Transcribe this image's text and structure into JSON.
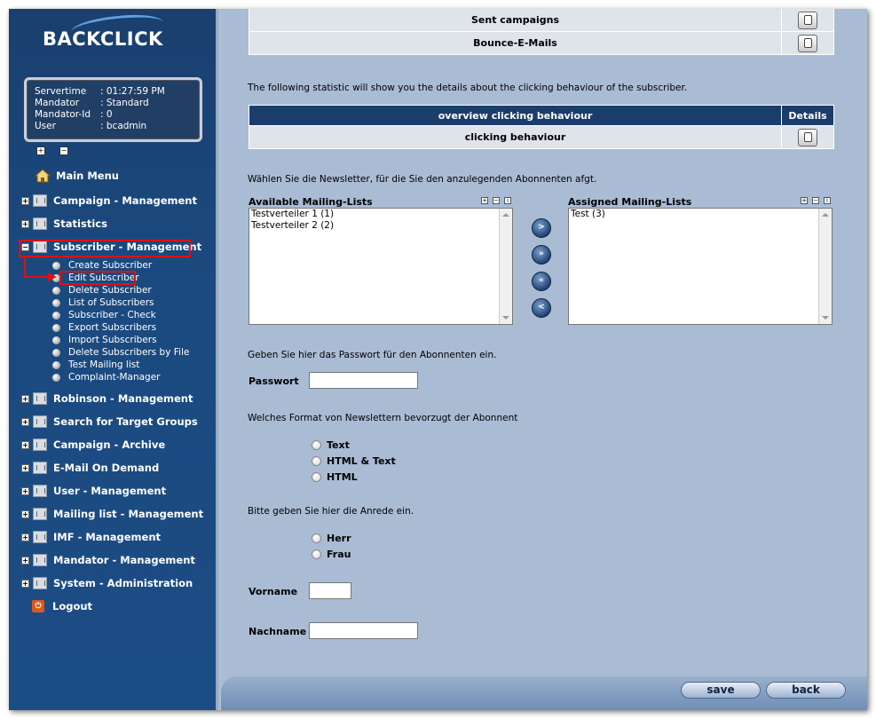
{
  "brand": {
    "name": "BACKCLICK"
  },
  "server_info": {
    "rows": [
      {
        "key": "Servertime",
        "value": ": 01:27:59 PM"
      },
      {
        "key": "Mandator",
        "value": ": Standard"
      },
      {
        "key": "Mandator-Id",
        "value": ": 0"
      },
      {
        "key": "User",
        "value": ": bcadmin"
      }
    ]
  },
  "nav": {
    "main_menu": "Main Menu",
    "items": [
      "Campaign - Management",
      "Statistics",
      "Subscriber - Management",
      "Robinson - Management",
      "Search for Target Groups",
      "Campaign - Archive",
      "E-Mail On Demand",
      "User - Management",
      "Mailing list - Management",
      "IMF - Management",
      "Mandator - Management",
      "System - Administration"
    ],
    "subitems": [
      "Create Subscriber",
      "Edit Subscriber",
      "Delete Subscriber",
      "List of Subscribers",
      "Subscriber - Check",
      "Export Subscribers",
      "Import Subscribers",
      "Delete Subscribers by File",
      "Test Mailing list",
      "Complaint-Manager"
    ],
    "logout": "Logout",
    "highlight_color": "#e01010"
  },
  "top_table": {
    "rows": [
      "Sent campaigns",
      "Bounce-E-Mails"
    ]
  },
  "click_text": "The following statistic will show you the details about the clicking behaviour of the subscriber.",
  "click_table": {
    "header": "overview clicking behaviour",
    "header_details": "Details",
    "row": "clicking behaviour"
  },
  "newsletter_text": "Wählen Sie die Newsletter, für die Sie den anzulegenden Abonnenten afgt.",
  "available": {
    "title": "Available Mailing-Lists",
    "options": [
      "Testverteiler 1 (1)",
      "Testverteiler 2 (2)"
    ]
  },
  "assigned": {
    "title": "Assigned Mailing-Lists",
    "options": [
      "Test (3)"
    ]
  },
  "move_buttons": [
    ">",
    "»",
    "«",
    "<"
  ],
  "password_text": "Geben Sie hier das Passwort für den Abonnenten ein.",
  "password_label": "Passwort",
  "format_text": "Welches Format von Newslettern bevorzugt der Abonnent",
  "format_options": [
    "Text",
    "HTML & Text",
    "HTML"
  ],
  "salutation_text": "Bitte geben Sie hier die Anrede ein.",
  "salutation_options": [
    "Herr",
    "Frau"
  ],
  "firstname_label": "Vorname",
  "lastname_label": "Nachname",
  "footer": {
    "save": "save",
    "back": "back"
  }
}
